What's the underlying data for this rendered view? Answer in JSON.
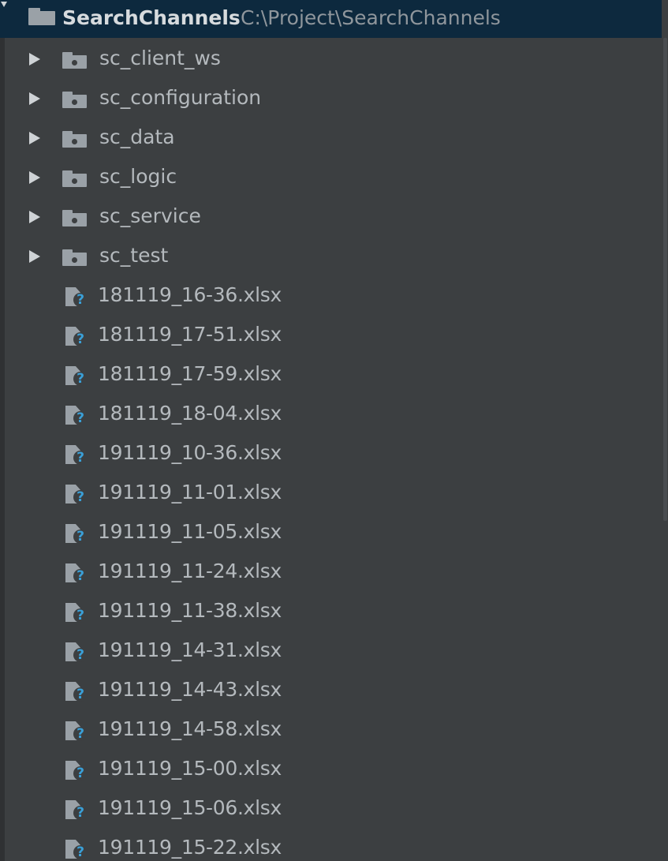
{
  "root": {
    "name": "SearchChannels",
    "path": "C:\\Project\\SearchChannels",
    "icon": "folder-icon"
  },
  "folders": [
    {
      "label": "sc_client_ws",
      "icon": "module-folder-icon"
    },
    {
      "label": "sc_configuration",
      "icon": "module-folder-icon"
    },
    {
      "label": "sc_data",
      "icon": "module-folder-icon"
    },
    {
      "label": "sc_logic",
      "icon": "module-folder-icon"
    },
    {
      "label": "sc_service",
      "icon": "module-folder-icon"
    },
    {
      "label": "sc_test",
      "icon": "module-folder-icon"
    }
  ],
  "files": [
    {
      "label": "181119_16-36.xlsx",
      "icon": "unknown-file-icon"
    },
    {
      "label": "181119_17-51.xlsx",
      "icon": "unknown-file-icon"
    },
    {
      "label": "181119_17-59.xlsx",
      "icon": "unknown-file-icon"
    },
    {
      "label": "181119_18-04.xlsx",
      "icon": "unknown-file-icon"
    },
    {
      "label": "191119_10-36.xlsx",
      "icon": "unknown-file-icon"
    },
    {
      "label": "191119_11-01.xlsx",
      "icon": "unknown-file-icon"
    },
    {
      "label": "191119_11-05.xlsx",
      "icon": "unknown-file-icon"
    },
    {
      "label": "191119_11-24.xlsx",
      "icon": "unknown-file-icon"
    },
    {
      "label": "191119_11-38.xlsx",
      "icon": "unknown-file-icon"
    },
    {
      "label": "191119_14-31.xlsx",
      "icon": "unknown-file-icon"
    },
    {
      "label": "191119_14-43.xlsx",
      "icon": "unknown-file-icon"
    },
    {
      "label": "191119_14-58.xlsx",
      "icon": "unknown-file-icon"
    },
    {
      "label": "191119_15-00.xlsx",
      "icon": "unknown-file-icon"
    },
    {
      "label": "191119_15-06.xlsx",
      "icon": "unknown-file-icon"
    },
    {
      "label": "191119_15-22.xlsx",
      "icon": "unknown-file-icon"
    }
  ],
  "colors": {
    "panel_background": "#3c3f41",
    "selected_row": "#0d293e",
    "text": "#b4b9bd",
    "path_text": "#8f969c",
    "icon_gray": "#9aa1a7",
    "question_mark": "#3aa0d8"
  }
}
